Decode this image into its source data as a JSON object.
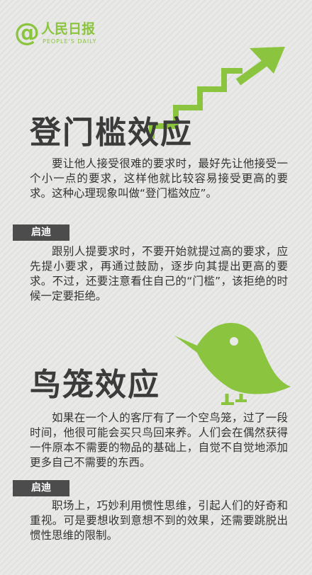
{
  "logo": {
    "symbol": "@",
    "name": "人民日报",
    "subtitle": "PEOPLE'S DAILY",
    "color": "#8bc43f"
  },
  "icons": {
    "stairs": "stairs-arrow-icon",
    "bird": "bird-icon"
  },
  "section1": {
    "title": "登门槛效应",
    "description": "要让他人接受很难的要求时，最好先让他接受一个小一点的要求，这样他就比较容易接受更高的要求。这种心理现象叫做“登门槛效应”。",
    "tip_label": "启迪",
    "tip": "跟别人提要求时，不要开始就提过高的要求，应先提小要求，再通过鼓励，逐步向其提出更高的要求。不过，还要注意看住自己的“门槛”，该拒绝的时候一定要拒绝。"
  },
  "section2": {
    "title": "鸟笼效应",
    "description": "如果在一个人的客厅有了一个空鸟笼，过了一段时间，他很可能会买只鸟回来养。人们会在偶然获得一件原本不需要的物品的基础上，自觉不自觉地添加更多自己不需要的东西。",
    "tip_label": "启迪",
    "tip": "职场上，巧妙利用惯性思维，引起人们的好奇和重视。可是要想收到意想不到的效果，还需要跳脱出惯性思维的限制。"
  },
  "colors": {
    "accent": "#8bc43f",
    "badge": "#4c4c4c",
    "background": "#e9e9e7"
  }
}
